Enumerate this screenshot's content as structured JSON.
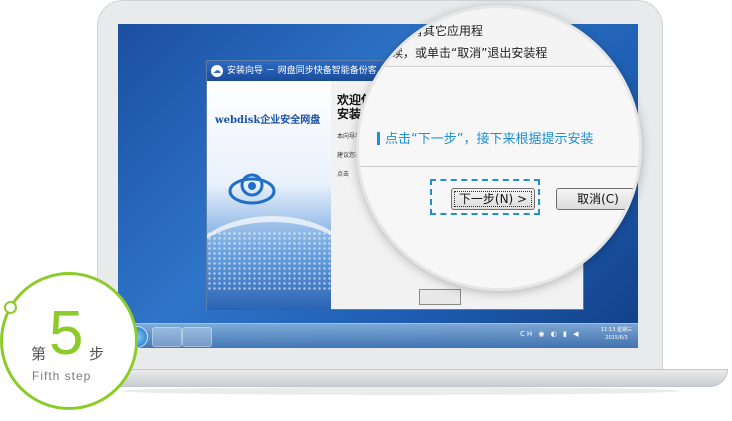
{
  "dialog": {
    "title": "安装向导 － 网盘同步快备智能备份客",
    "brand": "webdisk企业安全网盘",
    "welcome_line1": "欢迎使用网",
    "welcome_line2": "安装向导",
    "lines": [
      "本向导将",
      "建议您在",
      "点击"
    ]
  },
  "magnifier": {
    "top_text_1": "所有其它应用程",
    "top_text_2": "继续，或单击“取消”退出安装程",
    "hint": "点击“下一步”，接下来根据提示安装",
    "next_button": "下一步(N) >",
    "cancel_button": "取消(C)"
  },
  "taskbar": {
    "tray": "CH ◉ ◐ ▮ ◀",
    "time": "11:13 星期三",
    "date": "2015/6/3"
  },
  "step": {
    "prefix": "第",
    "number": "5",
    "suffix": "步",
    "english": "Fifth step"
  },
  "colors": {
    "accent_green": "#8ccc2a",
    "hint_blue": "#1f8fd6",
    "desktop_blue": "#2f75c9"
  },
  "icons": [
    "camera-icon",
    "cloud-logo-icon",
    "windows-start-icon",
    "explorer-icon",
    "chrome-icon",
    "tray-icons"
  ]
}
